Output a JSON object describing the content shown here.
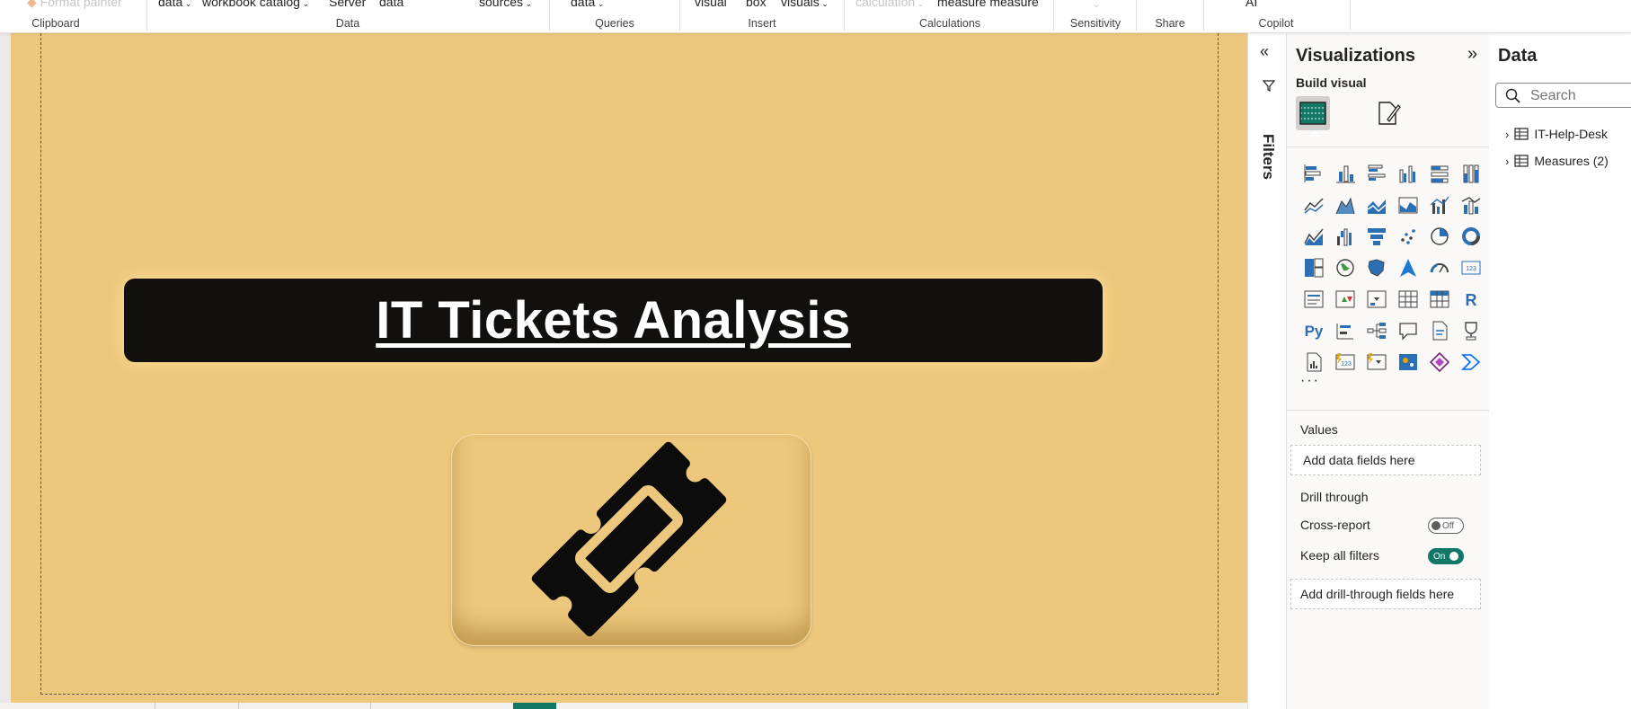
{
  "ribbon": {
    "top_items": [
      "Format painter",
      "data",
      "workbook catalog",
      "Server",
      "data",
      "sources",
      "data",
      "visual",
      "box",
      "visuals",
      "calculation",
      "measure measure",
      "AI"
    ],
    "groups": [
      "Clipboard",
      "Data",
      "Queries",
      "Insert",
      "Calculations",
      "Sensitivity",
      "Share",
      "Copilot"
    ]
  },
  "report": {
    "title": "IT Tickets Analysis",
    "background_color": "#edc77c",
    "title_box_color": "#12100e",
    "icon": "ticket-icon"
  },
  "filters": {
    "label": "Filters"
  },
  "visualizations": {
    "title": "Visualizations",
    "build_visual": "Build visual",
    "more_glyph": "···",
    "values_label": "Values",
    "values_placeholder": "Add data fields here",
    "drill_through_label": "Drill through",
    "cross_report_label": "Cross-report",
    "cross_report_state": "Off",
    "keep_filters_label": "Keep all filters",
    "keep_filters_state": "On",
    "drill_placeholder": "Add drill-through fields here",
    "accent_color": "#117865"
  },
  "data": {
    "title": "Data",
    "search_placeholder": "Search",
    "tables": [
      "IT-Help-Desk",
      "Measures (2)"
    ]
  }
}
